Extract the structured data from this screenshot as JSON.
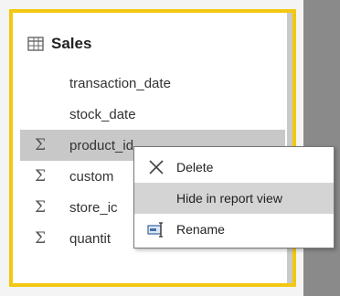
{
  "table": {
    "name": "Sales",
    "icon": "table-icon"
  },
  "fields": [
    {
      "label": "transaction_date",
      "aggregate": false,
      "icon": ""
    },
    {
      "label": "stock_date",
      "aggregate": false,
      "icon": ""
    },
    {
      "label": "product_id",
      "aggregate": true,
      "icon": "sigma-icon",
      "selected": true
    },
    {
      "label": "custom",
      "aggregate": true,
      "icon": "sigma-icon"
    },
    {
      "label": "store_ic",
      "aggregate": true,
      "icon": "sigma-icon"
    },
    {
      "label": "quantit",
      "aggregate": true,
      "icon": "sigma-icon"
    }
  ],
  "sigma_glyph": "Σ",
  "context_menu": {
    "items": [
      {
        "label": "Delete",
        "icon": "delete-x-icon"
      },
      {
        "label": "Hide in report view",
        "icon": ""
      },
      {
        "label": "Rename",
        "icon": "rename-icon"
      }
    ]
  },
  "colors": {
    "panel_border": "#f2c811",
    "selection": "#c8c8c8",
    "menu_hover": "#d4d4d4",
    "right_strip": "#8a8a8a"
  }
}
